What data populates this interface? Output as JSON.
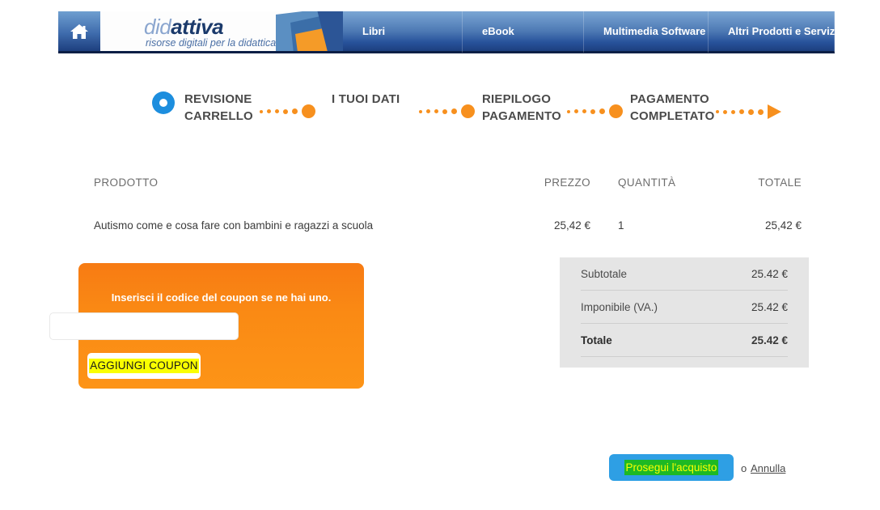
{
  "header": {
    "home_icon": "home-icon",
    "logo": {
      "part1": "did",
      "part2": "attiva",
      "tagline": "risorse digitali per la didattica"
    },
    "nav": [
      {
        "label": "Libri"
      },
      {
        "label": "eBook"
      },
      {
        "label": "Multimedia Software"
      },
      {
        "label": "Altri Prodotti e Servizi"
      }
    ]
  },
  "steps": [
    {
      "label": "REVISIONE\nCARRELLO",
      "marker": "ring",
      "state": "current"
    },
    {
      "label": "I TUOI DATI",
      "marker": "dot",
      "state": "upcoming"
    },
    {
      "label": "RIEPILOGO\nPAGAMENTO",
      "marker": "dot",
      "state": "upcoming"
    },
    {
      "label": "PAGAMENTO\nCOMPLETATO",
      "marker": "arrow",
      "state": "upcoming"
    }
  ],
  "cart": {
    "columns": {
      "product": "PRODOTTO",
      "price": "PREZZO",
      "quantity": "QUANTITÀ",
      "total": "TOTALE"
    },
    "rows": [
      {
        "product": "Autismo come e cosa fare con bambini e ragazzi a scuola",
        "price": "25,42 €",
        "quantity": "1",
        "total": "25,42 €"
      }
    ]
  },
  "coupon": {
    "title": "Inserisci il codice del coupon se ne hai uno.",
    "input_value": "",
    "input_placeholder": "",
    "submit_label": "AGGIUNGI COUPON"
  },
  "totals": [
    {
      "label": "Subtotale",
      "amount": "25.42 €"
    },
    {
      "label": "Imponibile (VA.)",
      "amount": "25.42 €"
    },
    {
      "label": "Totale",
      "amount": "25.42 €"
    }
  ],
  "footer": {
    "checkout_label": "Prosegui l'acquisto",
    "or_label": "o",
    "cancel_label": "Annulla"
  },
  "colors": {
    "nav_blue": "#27529b",
    "nav_dark": "#0b1f46",
    "orange": "#f7901e",
    "coupon_orange": "#fa8a14",
    "step_blue": "#1d8ede",
    "button_blue": "#2e9fe4",
    "highlight_yellow": "#faff00",
    "highlight_green": "#1db924",
    "totals_gray": "#e5e5e5"
  }
}
